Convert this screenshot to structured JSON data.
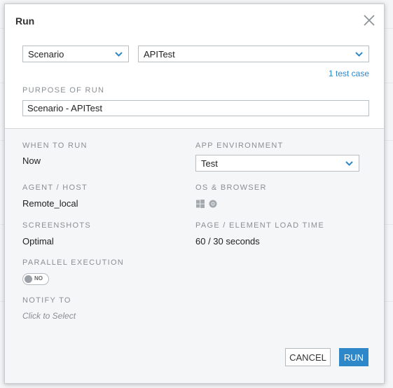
{
  "dialog": {
    "title": "Run"
  },
  "run_type": {
    "selected": "Scenario"
  },
  "target": {
    "selected": "APITest",
    "count_link": "1 test case"
  },
  "purpose": {
    "label": "PURPOSE OF RUN",
    "value": "Scenario - APITest"
  },
  "when": {
    "label": "WHEN TO RUN",
    "value": "Now"
  },
  "environment": {
    "label": "APP ENVIRONMENT",
    "selected": "Test"
  },
  "agent": {
    "label": "AGENT / HOST",
    "value": "Remote_local"
  },
  "os_browser": {
    "label": "OS & BROWSER",
    "icons": [
      "windows-icon",
      "chrome-icon"
    ]
  },
  "screenshots": {
    "label": "SCREENSHOTS",
    "value": "Optimal"
  },
  "load_time": {
    "label": "PAGE / ELEMENT LOAD TIME",
    "value": "60 / 30 seconds"
  },
  "parallel": {
    "label": "PARALLEL EXECUTION",
    "toggle_text": "NO"
  },
  "notify": {
    "label": "NOTIFY TO",
    "placeholder": "Click to Select"
  },
  "buttons": {
    "cancel": "CANCEL",
    "run": "RUN"
  },
  "colors": {
    "accent": "#2e87c8",
    "chevron": "#2e87c8"
  }
}
